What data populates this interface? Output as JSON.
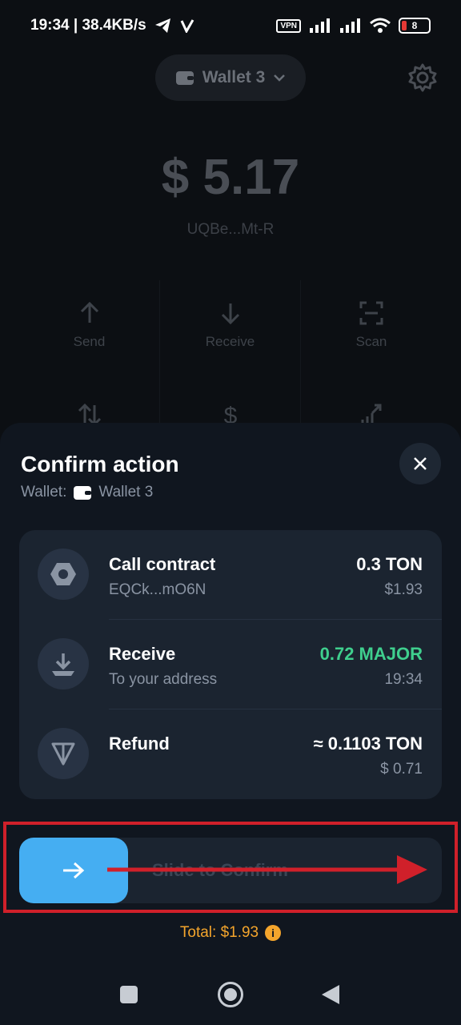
{
  "status_bar": {
    "time_speed": "19:34 | 38.4KB/s",
    "vpn": "VPN",
    "battery": "8"
  },
  "wallet": {
    "selected": "Wallet 3",
    "balance": "$ 5.17",
    "address": "UQBe...Mt-R",
    "actions": [
      {
        "label": "Send",
        "icon": "arrow-up-icon"
      },
      {
        "label": "Receive",
        "icon": "arrow-down-icon"
      },
      {
        "label": "Scan",
        "icon": "scan-icon"
      },
      {
        "label": "",
        "icon": "swap-icon"
      },
      {
        "label": "",
        "icon": "dollar-icon"
      },
      {
        "label": "",
        "icon": "stake-icon"
      }
    ]
  },
  "sheet": {
    "title": "Confirm action",
    "wallet_prefix": "Wallet:",
    "wallet_name": "Wallet 3",
    "rows": [
      {
        "title": "Call contract",
        "subtitle": "EQCk...mO6N",
        "amount": "0.3 TON",
        "amount_sub": "$1.93",
        "icon": "contract-icon"
      },
      {
        "title": "Receive",
        "subtitle": "To your address",
        "amount": "0.72 MAJOR",
        "amount_sub": "19:34",
        "icon": "download-icon",
        "amount_color": "#3fcf8e"
      },
      {
        "title": "Refund",
        "subtitle": "",
        "amount": "≈ 0.1103 TON",
        "amount_sub": "$ 0.71",
        "icon": "ton-icon"
      }
    ],
    "slider_label": "Slide to Confirm",
    "total": "Total: $1.93"
  },
  "colors": {
    "accent": "#45aef2",
    "positive": "#3fcf8e",
    "warning": "#f4a52c",
    "annotation": "#d0202a"
  }
}
